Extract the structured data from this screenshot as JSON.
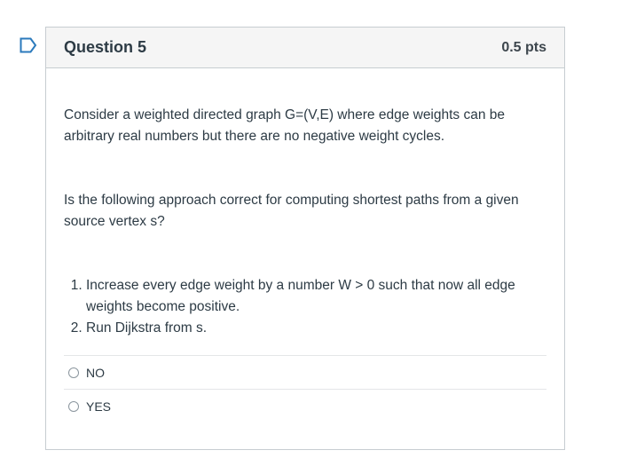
{
  "question": {
    "title": "Question 5",
    "points": "0.5 pts",
    "paragraph1": "Consider a weighted directed graph G=(V,E) where edge weights can be arbitrary real numbers but there are no negative weight cycles.",
    "paragraph2": "Is the following approach correct for computing shortest paths from a given source vertex s?",
    "steps": [
      "Increase every edge weight by a number W > 0 such that now all edge weights become positive.",
      "Run Dijkstra from s."
    ],
    "answers": [
      {
        "label": "NO",
        "selected": false
      },
      {
        "label": "YES",
        "selected": false
      }
    ]
  },
  "icons": {
    "flag": "flag-outline-icon"
  },
  "colors": {
    "flag": "#2b7abc",
    "header_bg": "#f5f5f5",
    "border": "#c7cdd1",
    "text": "#2d3b45"
  }
}
